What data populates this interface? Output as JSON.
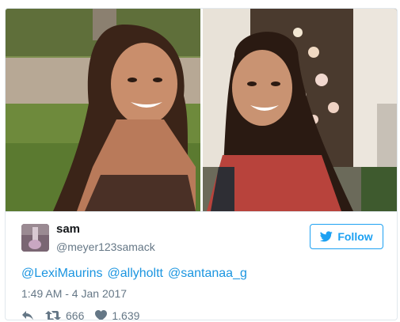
{
  "tweet": {
    "author": {
      "name": "sam",
      "handle": "@meyer123samack"
    },
    "follow_label": "Follow",
    "mentions": [
      "@LexiMaurins",
      "@allyholtt",
      "@santanaa_g"
    ],
    "timestamp": "1:49 AM - 4 Jan 2017",
    "retweet_count": "666",
    "like_count": "1,639"
  },
  "colors": {
    "accent": "#1da1f2",
    "link": "#1b95e0",
    "muted": "#657786"
  },
  "icons": {
    "reply": "reply-icon",
    "retweet": "retweet-icon",
    "like": "heart-icon",
    "follow": "twitter-bird-icon"
  }
}
